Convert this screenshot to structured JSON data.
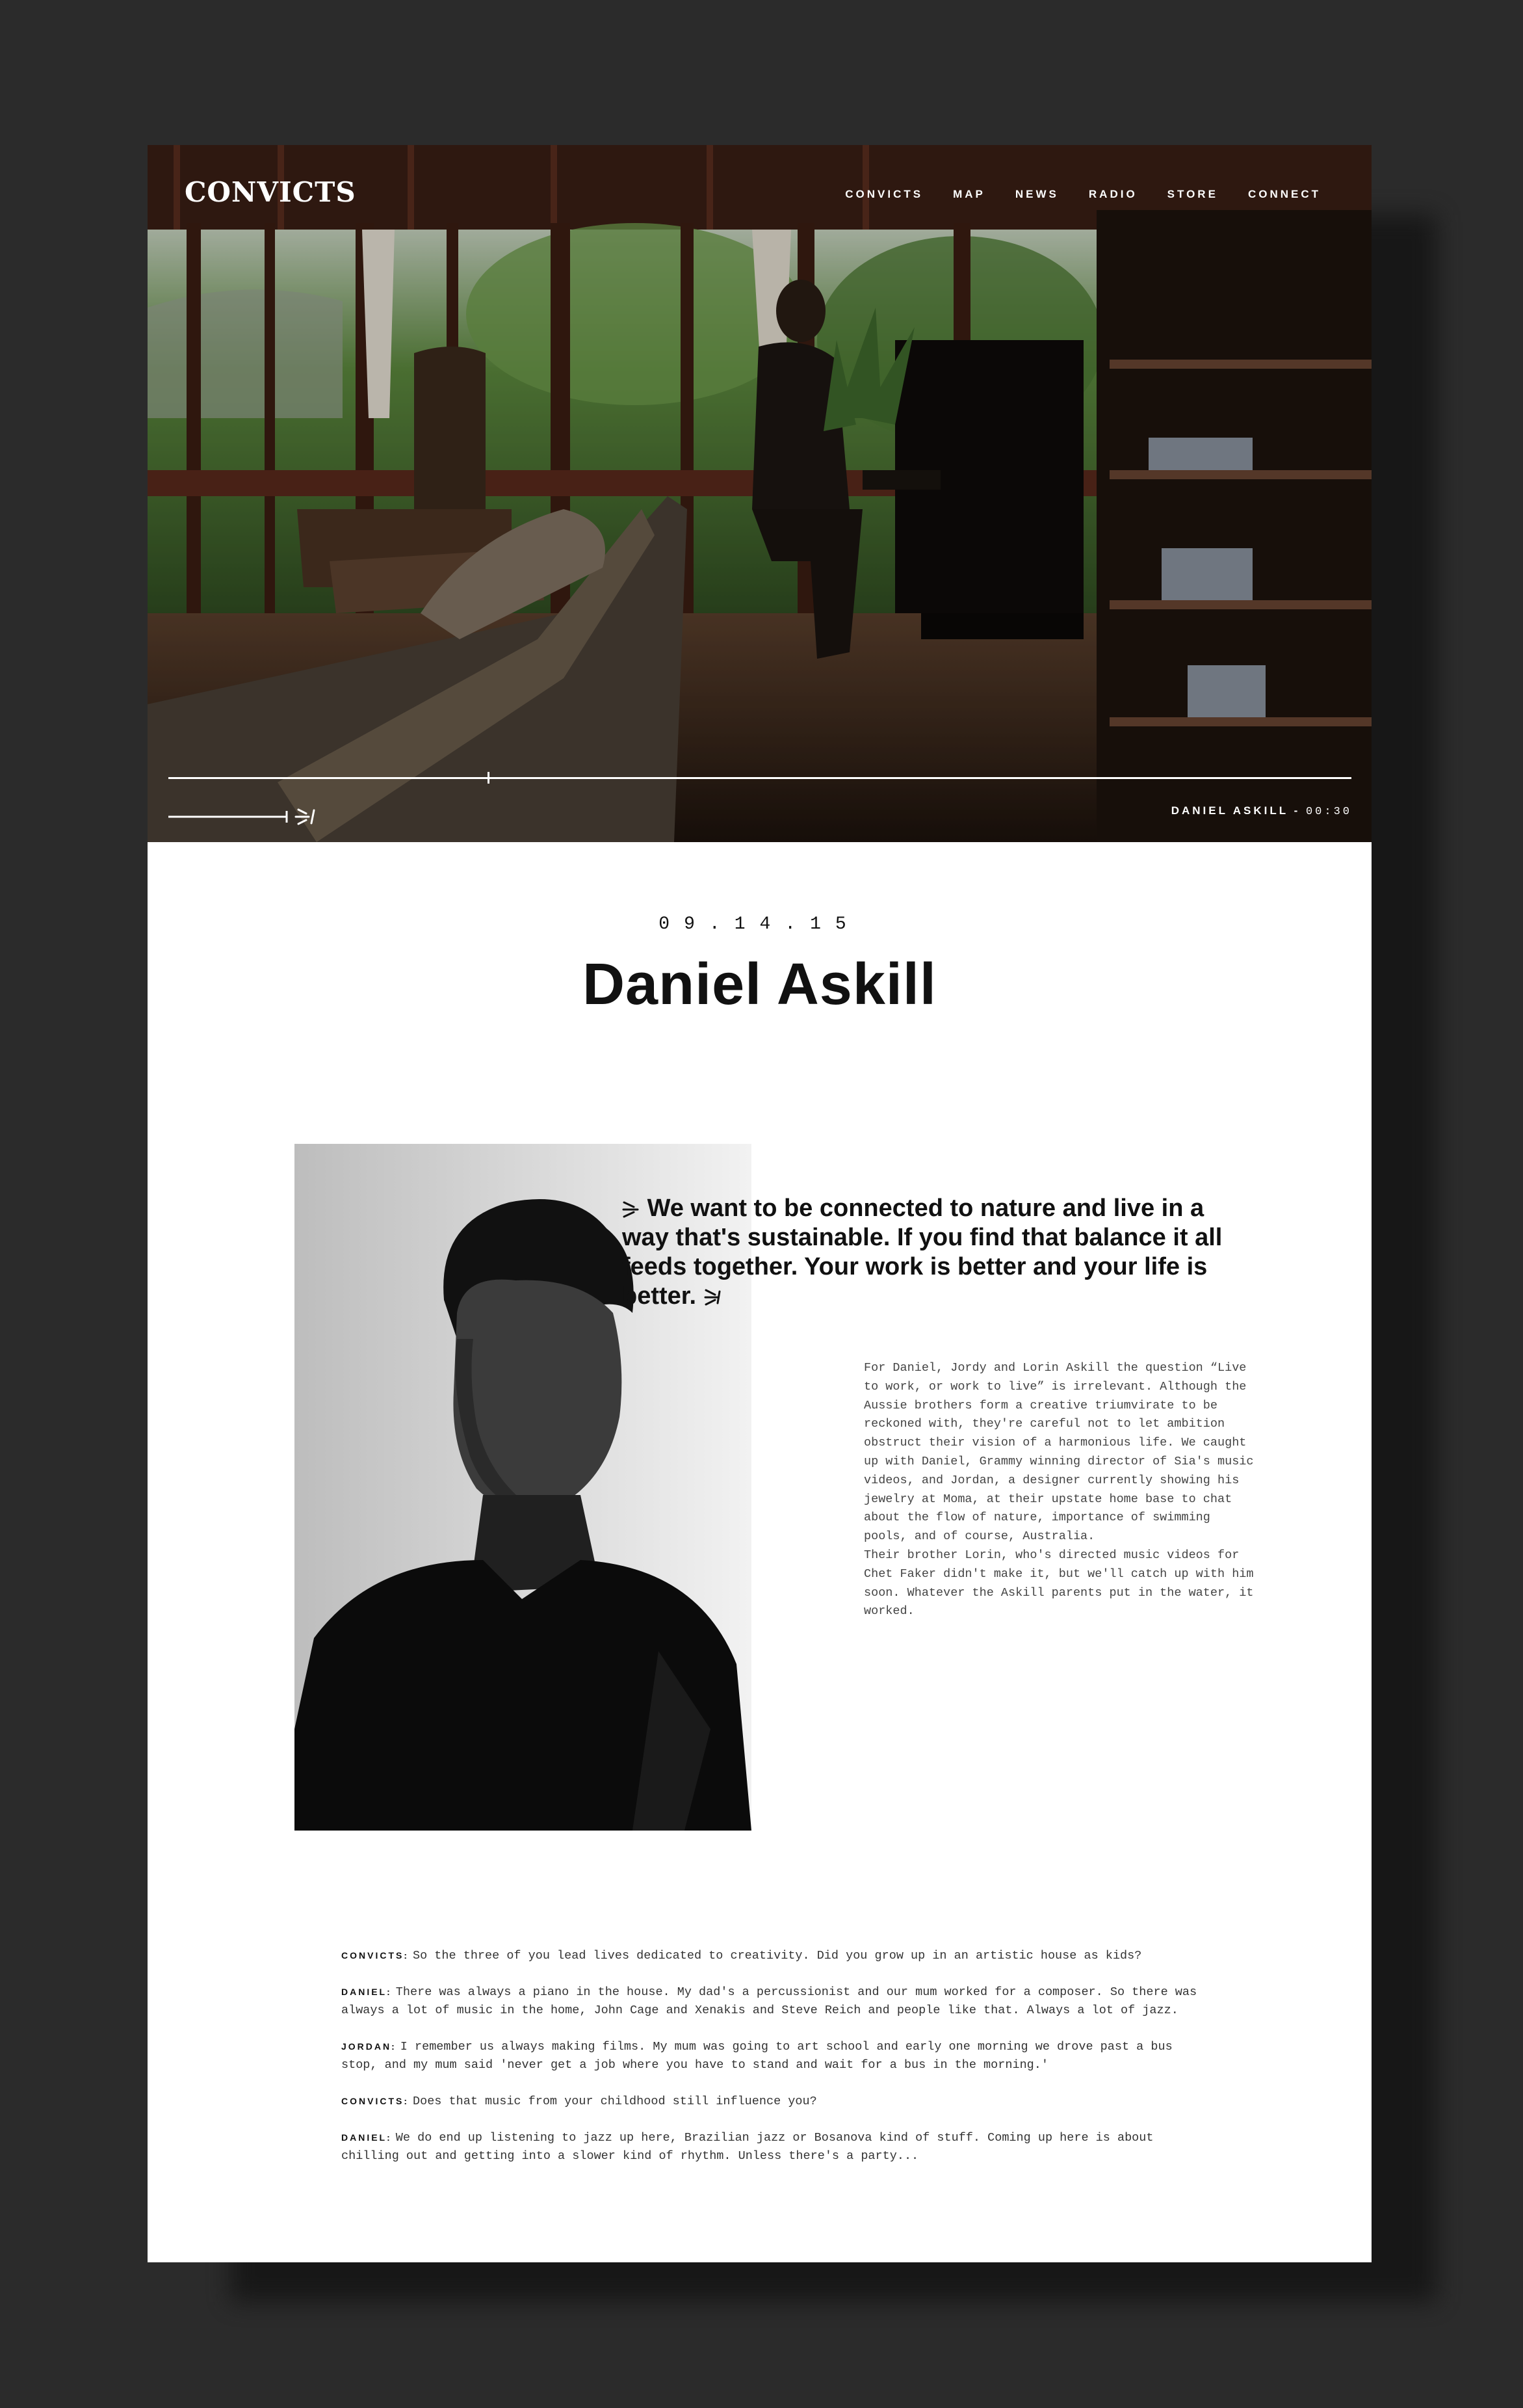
{
  "header": {
    "logo": "CONVICTS",
    "nav": [
      "CONVICTS",
      "MAP",
      "NEWS",
      "RADIO",
      "STORE",
      "CONNECT"
    ]
  },
  "player": {
    "caption_name": "DANIEL ASKILL -",
    "caption_time": "00:30",
    "progress": 0.27,
    "volume": 1.0
  },
  "article": {
    "date": "09.14.15",
    "title": "Daniel Askill",
    "quote": "We want to be connected to nature and live in a way that's sustainable. If you find that balance it all feeds together. Your work is better and your life is better.",
    "intro": [
      "For Daniel, Jordy and Lorin Askill the question “Live to work, or work to live” is irrelevant. Although the Aussie brothers form a creative triumvirate to be reckoned with, they're careful not to let ambition obstruct their vision of a harmonious life. We caught up with Daniel, Grammy winning director of Sia's music videos, and Jordan, a designer currently showing his jewelry at Moma, at their upstate home base to chat about the flow of nature, importance of swimming pools, and of course, Australia.",
      "Their brother Lorin, who's directed music videos for Chet Faker didn't make it, but we'll catch up with him soon. Whatever the Askill parents put in the water, it worked."
    ],
    "interview": [
      {
        "speaker": "CONVICTS:",
        "text": "So the three of you lead lives dedicated to creativity. Did you grow up in an artistic house as kids?"
      },
      {
        "speaker": "DANIEL:",
        "text": "There was always a piano in the house. My dad's a percussionist and our mum worked for a composer. So there was always a lot of music in the home, John Cage and Xenakis and Steve Reich and people like that. Always a lot of jazz."
      },
      {
        "speaker": "JORDAN:",
        "text": "I remember us always making films. My mum was going to art school and early one morning we drove past a bus stop, and my mum said 'never get a job where you have to stand and wait for a bus in the morning.'"
      },
      {
        "speaker": "CONVICTS:",
        "text": "Does that music from your childhood still influence you?"
      },
      {
        "speaker": "DANIEL:",
        "text": "We do end up listening to jazz up here, Brazilian jazz or Bosanova kind of stuff. Coming up here is about chilling out and getting into a slower kind of rhythm. Unless there's a party..."
      }
    ]
  }
}
